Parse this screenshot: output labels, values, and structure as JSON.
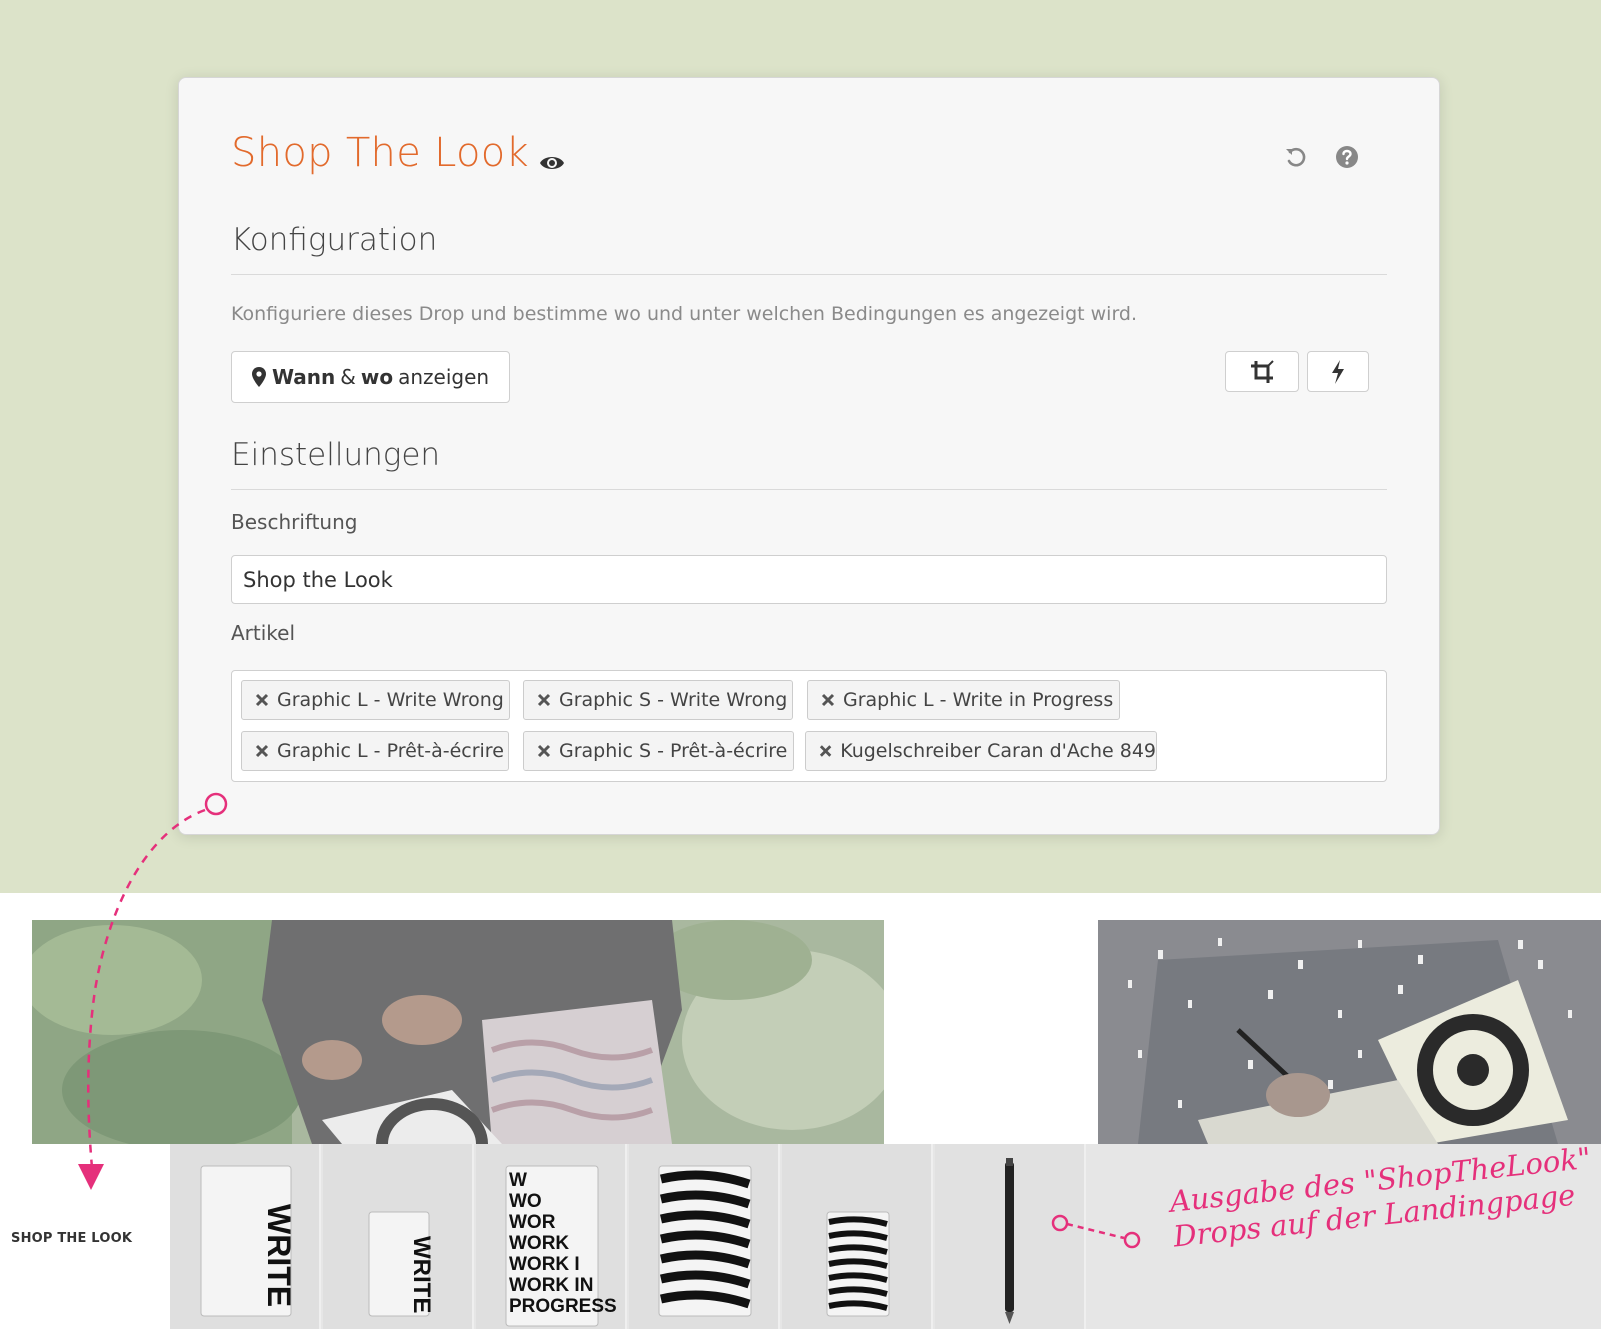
{
  "panel": {
    "title": "Shop The Look",
    "icons": [
      "eye-icon",
      "undo-icon",
      "help-icon"
    ]
  },
  "konfiguration": {
    "heading": "Konfiguration",
    "description": "Konfiguriere dieses Drop und bestimme wo und unter welchen Bedingungen es angezeigt wird.",
    "where_button": {
      "w1": "Wann",
      "amp": "&",
      "w2": "wo",
      "w3": "anzeigen"
    },
    "tool_icons": [
      "crop-icon",
      "bolt-icon"
    ]
  },
  "einstellungen": {
    "heading": "Einstellungen",
    "beschriftung_label": "Beschriftung",
    "beschriftung_value": "Shop the Look",
    "artikel_label": "Artikel",
    "artikel": [
      "Graphic L - Write Wrong",
      "Graphic S - Write Wrong",
      "Graphic L - Write in Progress",
      "Graphic L - Prêt-à-écrire",
      "Graphic S - Prêt-à-écrire",
      "Kugelschreiber Caran d'Ache 849"
    ]
  },
  "landingpage": {
    "shop_label": "SHOP THE LOOK",
    "notebook_texts": {
      "write": "WRITE",
      "progress": [
        "W",
        "WO",
        "WOR",
        "WORK",
        "WORK I",
        "WORK IN",
        "PROGRESS"
      ]
    },
    "annotation_line1": "Ausgabe des \"ShopTheLook\"",
    "annotation_line2": "Drops auf der Landingpage"
  },
  "colors": {
    "accent": "#e26a2c",
    "annotation": "#e5307b",
    "background": "#dce3c9"
  }
}
